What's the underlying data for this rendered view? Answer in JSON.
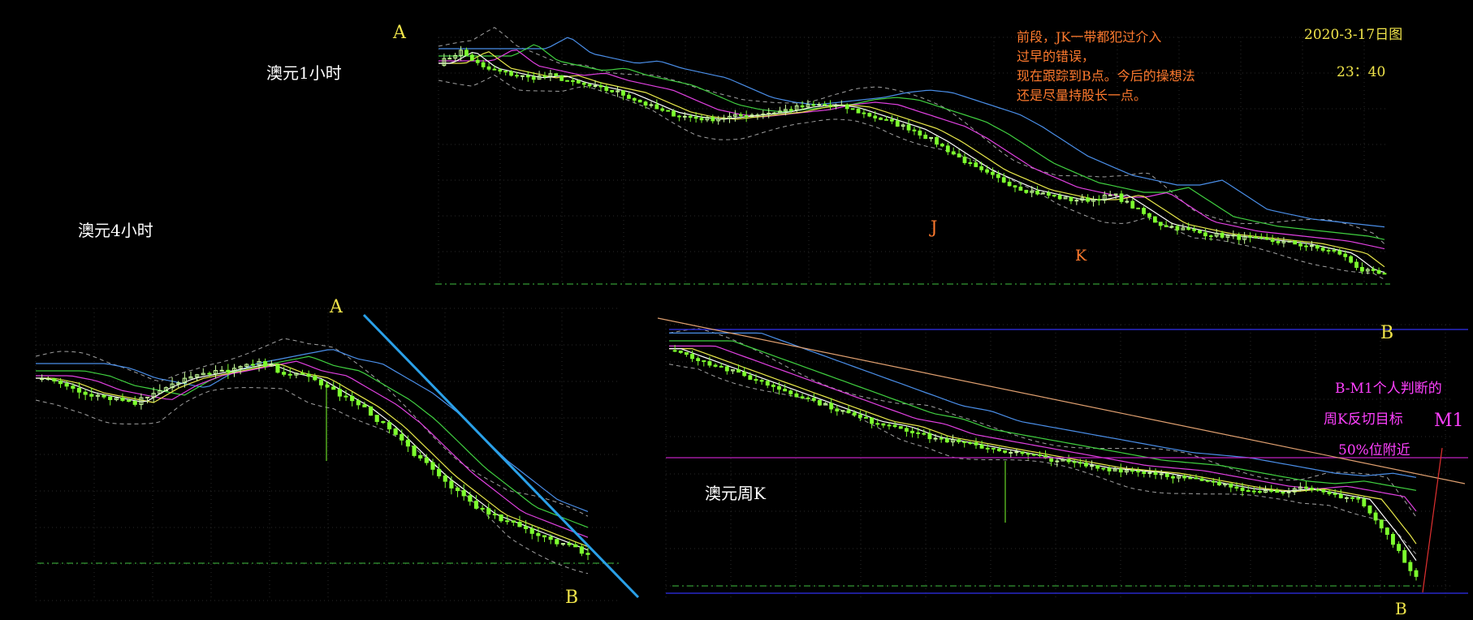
{
  "labels": {
    "a_top": "A",
    "a_left": "A",
    "b_top": "B",
    "b_left": "B",
    "b_right": "B",
    "j": "J",
    "k": "K",
    "m1": "M1",
    "title_1h": "澳元1小时",
    "title_4h": "澳元4小时",
    "title_weekly": "澳元周K",
    "date": "2020-3-17日图",
    "time": "23：40",
    "note_lines": [
      "前段，JK一带都犯过介入",
      "过早的错误，",
      "现在跟踪到B点。今后的操想法",
      "还是尽量持股长一点。"
    ],
    "target_lines": [
      "B-M1个人判断的",
      "周K反切目标",
      "50%位附近"
    ]
  },
  "colors": {
    "background": "#000000",
    "bull_candle": "#c8ff9a",
    "bear_candle": "#7dff2e",
    "ma_white": "#ffffff",
    "ma_yellow": "#e8e84a",
    "ma_magenta": "#e040e0",
    "ma_green": "#40d040",
    "ma_blue": "#4a8ee8",
    "band": "#a0a0a0",
    "trendline": "#2aa0e8",
    "support_dash": "#40c040",
    "weekly_hline_blue": "#2828c8",
    "weekly_hline_magenta": "#c020c0",
    "weekly_diag": "#e0a070",
    "m1_line": "#e03030"
  },
  "chart_data": [
    {
      "type": "candlestick",
      "name": "1h",
      "title": "澳元1小时",
      "ylim": [
        0,
        100
      ],
      "points": [
        [
          0,
          90
        ],
        [
          3,
          95
        ],
        [
          6,
          88
        ],
        [
          9,
          86
        ],
        [
          12,
          84
        ],
        [
          15,
          85
        ],
        [
          18,
          82
        ],
        [
          21,
          80
        ],
        [
          24,
          78
        ],
        [
          27,
          74
        ],
        [
          30,
          70
        ],
        [
          33,
          68
        ],
        [
          36,
          67
        ],
        [
          39,
          68
        ],
        [
          42,
          69
        ],
        [
          45,
          70
        ],
        [
          48,
          72
        ],
        [
          51,
          73
        ],
        [
          54,
          72
        ],
        [
          57,
          69
        ],
        [
          60,
          66
        ],
        [
          63,
          63
        ],
        [
          66,
          58
        ],
        [
          69,
          52
        ],
        [
          72,
          46
        ],
        [
          75,
          42
        ],
        [
          78,
          38
        ],
        [
          81,
          36
        ],
        [
          84,
          34
        ],
        [
          87,
          34
        ],
        [
          90,
          36
        ],
        [
          93,
          30
        ],
        [
          96,
          24
        ],
        [
          99,
          22
        ],
        [
          102,
          20
        ],
        [
          105,
          19
        ],
        [
          108,
          18
        ],
        [
          111,
          17
        ],
        [
          114,
          16
        ],
        [
          117,
          14
        ],
        [
          120,
          12
        ],
        [
          123,
          5
        ],
        [
          126,
          3
        ]
      ],
      "annotations": [
        {
          "text": "J",
          "x": 72
        },
        {
          "text": "K",
          "x": 93
        },
        {
          "text": "B",
          "x": 126
        }
      ]
    },
    {
      "type": "candlestick",
      "name": "4h",
      "title": "澳元4小时",
      "ylim": [
        0,
        100
      ],
      "points": [
        [
          0,
          78
        ],
        [
          4,
          76
        ],
        [
          8,
          72
        ],
        [
          12,
          70
        ],
        [
          16,
          68
        ],
        [
          20,
          74
        ],
        [
          24,
          78
        ],
        [
          28,
          80
        ],
        [
          32,
          82
        ],
        [
          36,
          84
        ],
        [
          40,
          80
        ],
        [
          44,
          78
        ],
        [
          48,
          72
        ],
        [
          52,
          66
        ],
        [
          56,
          58
        ],
        [
          60,
          48
        ],
        [
          64,
          38
        ],
        [
          68,
          30
        ],
        [
          72,
          22
        ],
        [
          76,
          18
        ],
        [
          80,
          14
        ],
        [
          84,
          10
        ],
        [
          88,
          6
        ]
      ],
      "annotations": [
        {
          "text": "A",
          "x": 36
        },
        {
          "text": "B",
          "x": 88
        }
      ]
    },
    {
      "type": "candlestick",
      "name": "weekly",
      "title": "澳元周K",
      "ylim": [
        0,
        100
      ],
      "points": [
        [
          0,
          92
        ],
        [
          4,
          88
        ],
        [
          8,
          84
        ],
        [
          12,
          80
        ],
        [
          16,
          76
        ],
        [
          20,
          72
        ],
        [
          24,
          68
        ],
        [
          28,
          64
        ],
        [
          32,
          62
        ],
        [
          36,
          58
        ],
        [
          40,
          56
        ],
        [
          44,
          54
        ],
        [
          48,
          52
        ],
        [
          52,
          50
        ],
        [
          56,
          48
        ],
        [
          60,
          46
        ],
        [
          64,
          45
        ],
        [
          68,
          44
        ],
        [
          72,
          42
        ],
        [
          76,
          40
        ],
        [
          80,
          38
        ],
        [
          84,
          37
        ],
        [
          88,
          38
        ],
        [
          92,
          36
        ],
        [
          96,
          34
        ],
        [
          100,
          20
        ],
        [
          104,
          4
        ]
      ],
      "annotations": [
        {
          "text": "B",
          "x": 104
        },
        {
          "text": "M1",
          "x": 108
        }
      ]
    }
  ]
}
